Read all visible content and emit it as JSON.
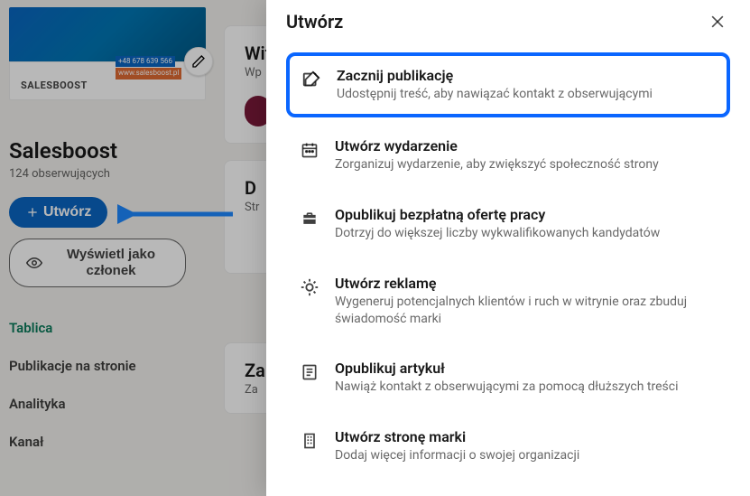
{
  "sidebar": {
    "logo_text": "SALESBOOST",
    "biz_phone": "+48 678 639 566",
    "biz_site": "www.salesboost.pl",
    "page_name": "Salesboost",
    "followers": "124 obserwujących",
    "create_label": "Utwórz",
    "view_as_label": "Wyświetl jako członek",
    "nav": {
      "tablica": "Tablica",
      "publikacje": "Publikacje na stronie",
      "analityka": "Analityka",
      "kanal": "Kanał"
    }
  },
  "maincol": {
    "card1": {
      "h": "Wit",
      "sub": "Wp"
    },
    "card2": {
      "h": "D",
      "sub": "Str"
    },
    "card3": {
      "h": "Za",
      "sub": "Za"
    }
  },
  "modal": {
    "title": "Utwórz",
    "options": [
      {
        "title": "Zacznij publikację",
        "desc": "Udostępnij treść, aby nawiązać kontakt z obserwującymi"
      },
      {
        "title": "Utwórz wydarzenie",
        "desc": "Zorganizuj wydarzenie, aby zwiększyć społeczność strony"
      },
      {
        "title": "Opublikuj bezpłatną ofertę pracy",
        "desc": "Dotrzyj do większej liczby wykwalifikowanych kandydatów"
      },
      {
        "title": "Utwórz reklamę",
        "desc": "Wygeneruj potencjalnych klientów i ruch w witrynie oraz zbuduj świadomość marki"
      },
      {
        "title": "Opublikuj artykuł",
        "desc": "Nawiąż kontakt z obserwującymi za pomocą dłuższych treści"
      },
      {
        "title": "Utwórz stronę marki",
        "desc": "Dodaj więcej informacji o swojej organizacji"
      }
    ]
  }
}
